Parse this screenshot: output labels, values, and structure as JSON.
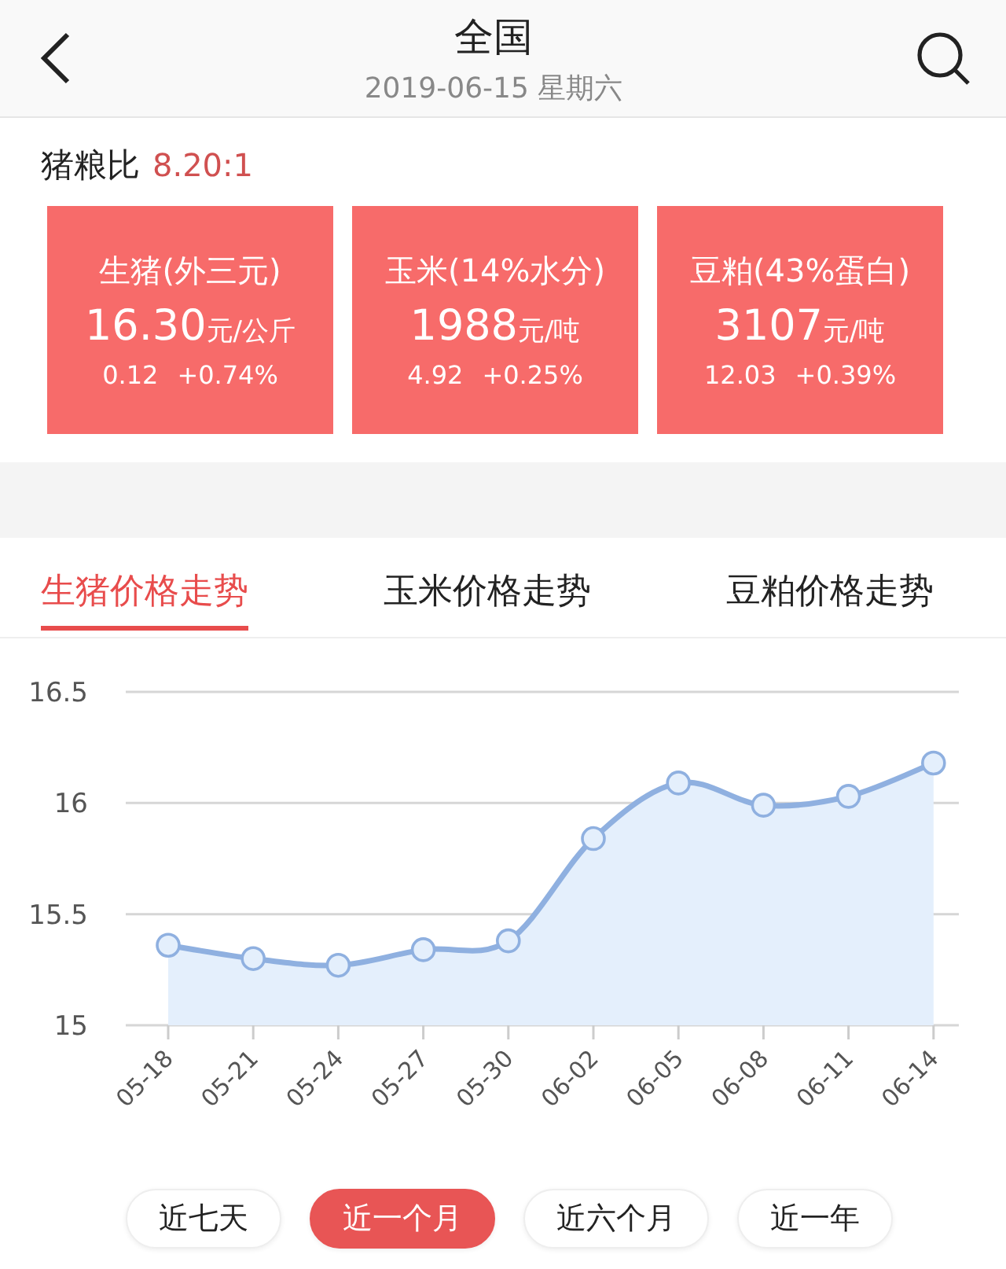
{
  "header": {
    "title": "全国",
    "subtitle": "2019-06-15 星期六"
  },
  "ratio": {
    "label": "猪粮比",
    "value": "8.20:1"
  },
  "cards": [
    {
      "name": "生猪(外三元)",
      "price": "16.30",
      "unit": "元/公斤",
      "change": "0.12",
      "percent": "+0.74%"
    },
    {
      "name": "玉米(14%水分)",
      "price": "1988",
      "unit": "元/吨",
      "change": "4.92",
      "percent": "+0.25%"
    },
    {
      "name": "豆粕(43%蛋白)",
      "price": "3107",
      "unit": "元/吨",
      "change": "12.03",
      "percent": "+0.39%"
    }
  ],
  "tabs": [
    {
      "label": "生猪价格走势",
      "selected": true
    },
    {
      "label": "玉米价格走势",
      "selected": false
    },
    {
      "label": "豆粕价格走势",
      "selected": false
    }
  ],
  "chart": {
    "chart_data": {
      "type": "area",
      "categories": [
        "05-18",
        "05-21",
        "05-24",
        "05-27",
        "05-30",
        "06-02",
        "06-05",
        "06-08",
        "06-11",
        "06-14"
      ],
      "series": [
        {
          "color": "#8fb0e0",
          "values": [
            15.36,
            15.3,
            15.27,
            15.34,
            15.38,
            15.84,
            16.09,
            15.99,
            16.03,
            16.18
          ]
        }
      ],
      "ylim": [
        15,
        16.5
      ],
      "yticks": [
        {
          "value": 15,
          "label": "15"
        },
        {
          "value": 15.5,
          "label": "15.5"
        },
        {
          "value": 16,
          "label": "16"
        },
        {
          "value": 16.5,
          "label": "16.5"
        }
      ]
    }
  },
  "ranges": [
    {
      "label": "近七天",
      "selected": false
    },
    {
      "label": "近一个月",
      "selected": true
    },
    {
      "label": "近六个月",
      "selected": false
    },
    {
      "label": "近一年",
      "selected": false
    }
  ]
}
